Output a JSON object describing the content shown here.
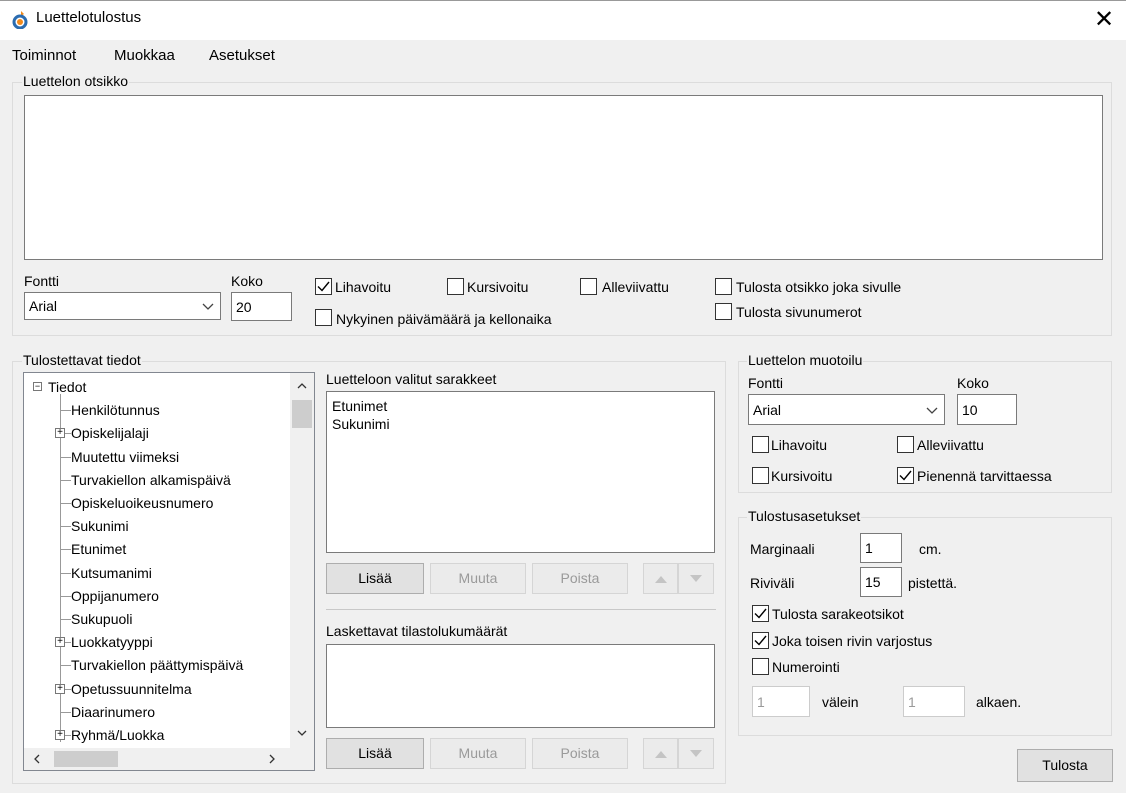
{
  "window": {
    "title": "Luettelotulostus",
    "close_glyph": "✕"
  },
  "menu": [
    "Toiminnot",
    "Muokkaa",
    "Asetukset"
  ],
  "header_group": {
    "legend": "Luettelon otsikko",
    "title_value": "",
    "font_label": "Fontti",
    "font_value": "Arial",
    "size_label": "Koko",
    "size_value": "20",
    "checkboxes": [
      {
        "label": "Lihavoitu",
        "checked": true
      },
      {
        "label": "Kursivoitu",
        "checked": false
      },
      {
        "label": "Alleviivattu",
        "checked": false
      },
      {
        "label": "Tulosta otsikko joka sivulle",
        "checked": false
      },
      {
        "label": "Nykyinen päivämäärä ja kellonaika",
        "checked": false
      },
      {
        "label": "Tulosta sivunumerot",
        "checked": false
      }
    ]
  },
  "data_group": {
    "legend": "Tulostettavat tiedot",
    "tree": [
      {
        "label": "Tiedot",
        "expander": "−",
        "level": 0
      },
      {
        "label": "Henkilötunnus",
        "expander": "",
        "level": 1
      },
      {
        "label": "Opiskelijalaji",
        "expander": "+",
        "level": 1
      },
      {
        "label": "Muutettu viimeksi",
        "expander": "",
        "level": 1
      },
      {
        "label": "Turvakiellon alkamispäivä",
        "expander": "",
        "level": 1
      },
      {
        "label": "Opiskeluoikeusnumero",
        "expander": "",
        "level": 1
      },
      {
        "label": "Sukunimi",
        "expander": "",
        "level": 1
      },
      {
        "label": "Etunimet",
        "expander": "",
        "level": 1
      },
      {
        "label": "Kutsumanimi",
        "expander": "",
        "level": 1
      },
      {
        "label": "Oppijanumero",
        "expander": "",
        "level": 1
      },
      {
        "label": "Sukupuoli",
        "expander": "",
        "level": 1
      },
      {
        "label": "Luokkatyyppi",
        "expander": "+",
        "level": 1
      },
      {
        "label": "Turvakiellon päättymispäivä",
        "expander": "",
        "level": 1
      },
      {
        "label": "Opetussuunnitelma",
        "expander": "+",
        "level": 1
      },
      {
        "label": "Diaarinumero",
        "expander": "",
        "level": 1
      },
      {
        "label": "Ryhmä/Luokka",
        "expander": "+",
        "level": 1
      }
    ],
    "selected_columns_label": "Luetteloon valitut sarakkeet",
    "selected_columns": [
      "Etunimet",
      "Sukunimi"
    ],
    "stats_label": "Laskettavat tilastolukumäärät",
    "stats_items": [],
    "buttons": {
      "add": "Lisää",
      "modify": "Muuta",
      "remove": "Poista"
    }
  },
  "format_group": {
    "legend": "Luettelon muotoilu",
    "font_label": "Fontti",
    "font_value": "Arial",
    "size_label": "Koko",
    "size_value": "10",
    "checkboxes": [
      {
        "label": "Lihavoitu",
        "checked": false
      },
      {
        "label": "Alleviivattu",
        "checked": false
      },
      {
        "label": "Kursivoitu",
        "checked": false
      },
      {
        "label": "Pienennä tarvittaessa",
        "checked": true
      }
    ]
  },
  "print_group": {
    "legend": "Tulostusasetukset",
    "margin_label": "Marginaali",
    "margin_value": "1",
    "margin_unit": "cm.",
    "spacing_label": "Riviväli",
    "spacing_value": "15",
    "spacing_unit": "pistettä.",
    "checkboxes": [
      {
        "label": "Tulosta sarakeotsikot",
        "checked": true
      },
      {
        "label": "Joka toisen rivin varjostus",
        "checked": true
      },
      {
        "label": "Numerointi",
        "checked": false
      }
    ],
    "numbering_interval_value": "1",
    "numbering_interval_label": "välein",
    "numbering_start_value": "1",
    "numbering_start_label": "alkaen."
  },
  "print_button": "Tulosta"
}
